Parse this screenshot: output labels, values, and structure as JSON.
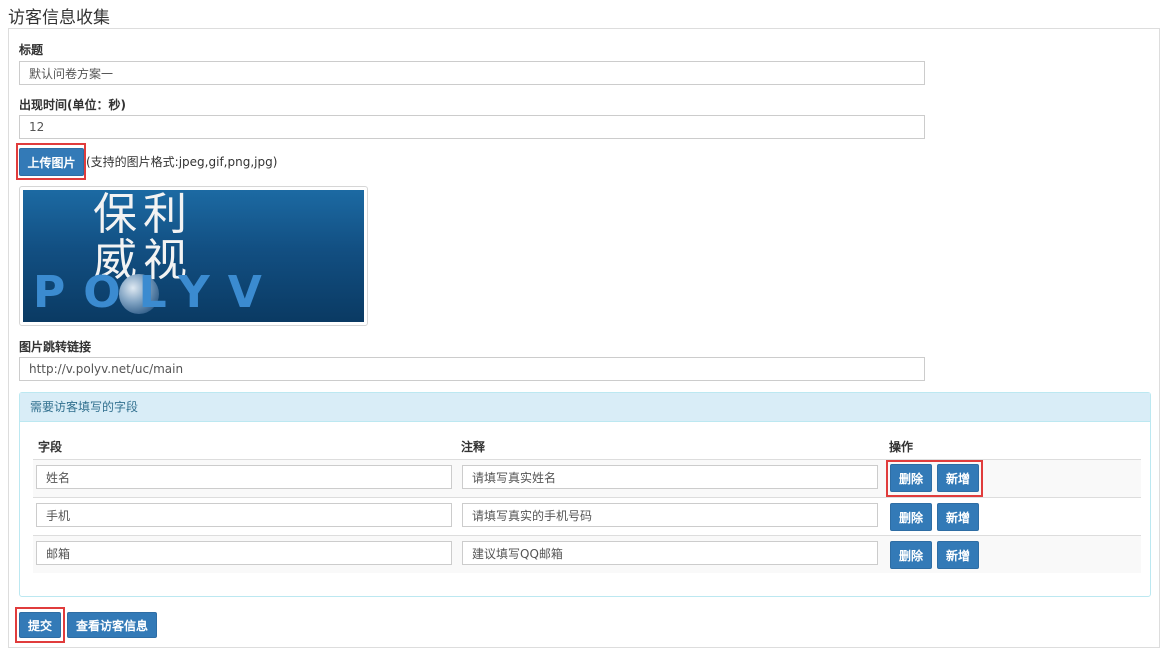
{
  "page": {
    "title": "访客信息收集"
  },
  "form": {
    "title_label": "标题",
    "title_value": "默认问卷方案一",
    "time_label": "出现时间(单位：秒)",
    "time_value": "12",
    "upload_button": "上传图片",
    "upload_hint": "(支持的图片格式:jpeg,gif,png,jpg)",
    "logo_cn_line1": "保利",
    "logo_cn_line2": "威视",
    "logo_en": "POLYV",
    "link_label": "图片跳转链接",
    "link_value": "http://v.polyv.net/uc/main"
  },
  "fields": {
    "panel_title": "需要访客填写的字段",
    "headers": {
      "field": "字段",
      "note": "注释",
      "action": "操作"
    },
    "delete_label": "删除",
    "add_label": "新增",
    "rows": [
      {
        "field": "姓名",
        "note": "请填写真实姓名"
      },
      {
        "field": "手机",
        "note": "请填写真实的手机号码"
      },
      {
        "field": "邮箱",
        "note": "建议填写QQ邮箱"
      }
    ]
  },
  "footer": {
    "submit_label": "提交",
    "view_label": "查看访客信息"
  },
  "colors": {
    "primary": "#337ab7",
    "highlight": "#e03c3c",
    "panel_head_bg": "#d9edf7"
  }
}
